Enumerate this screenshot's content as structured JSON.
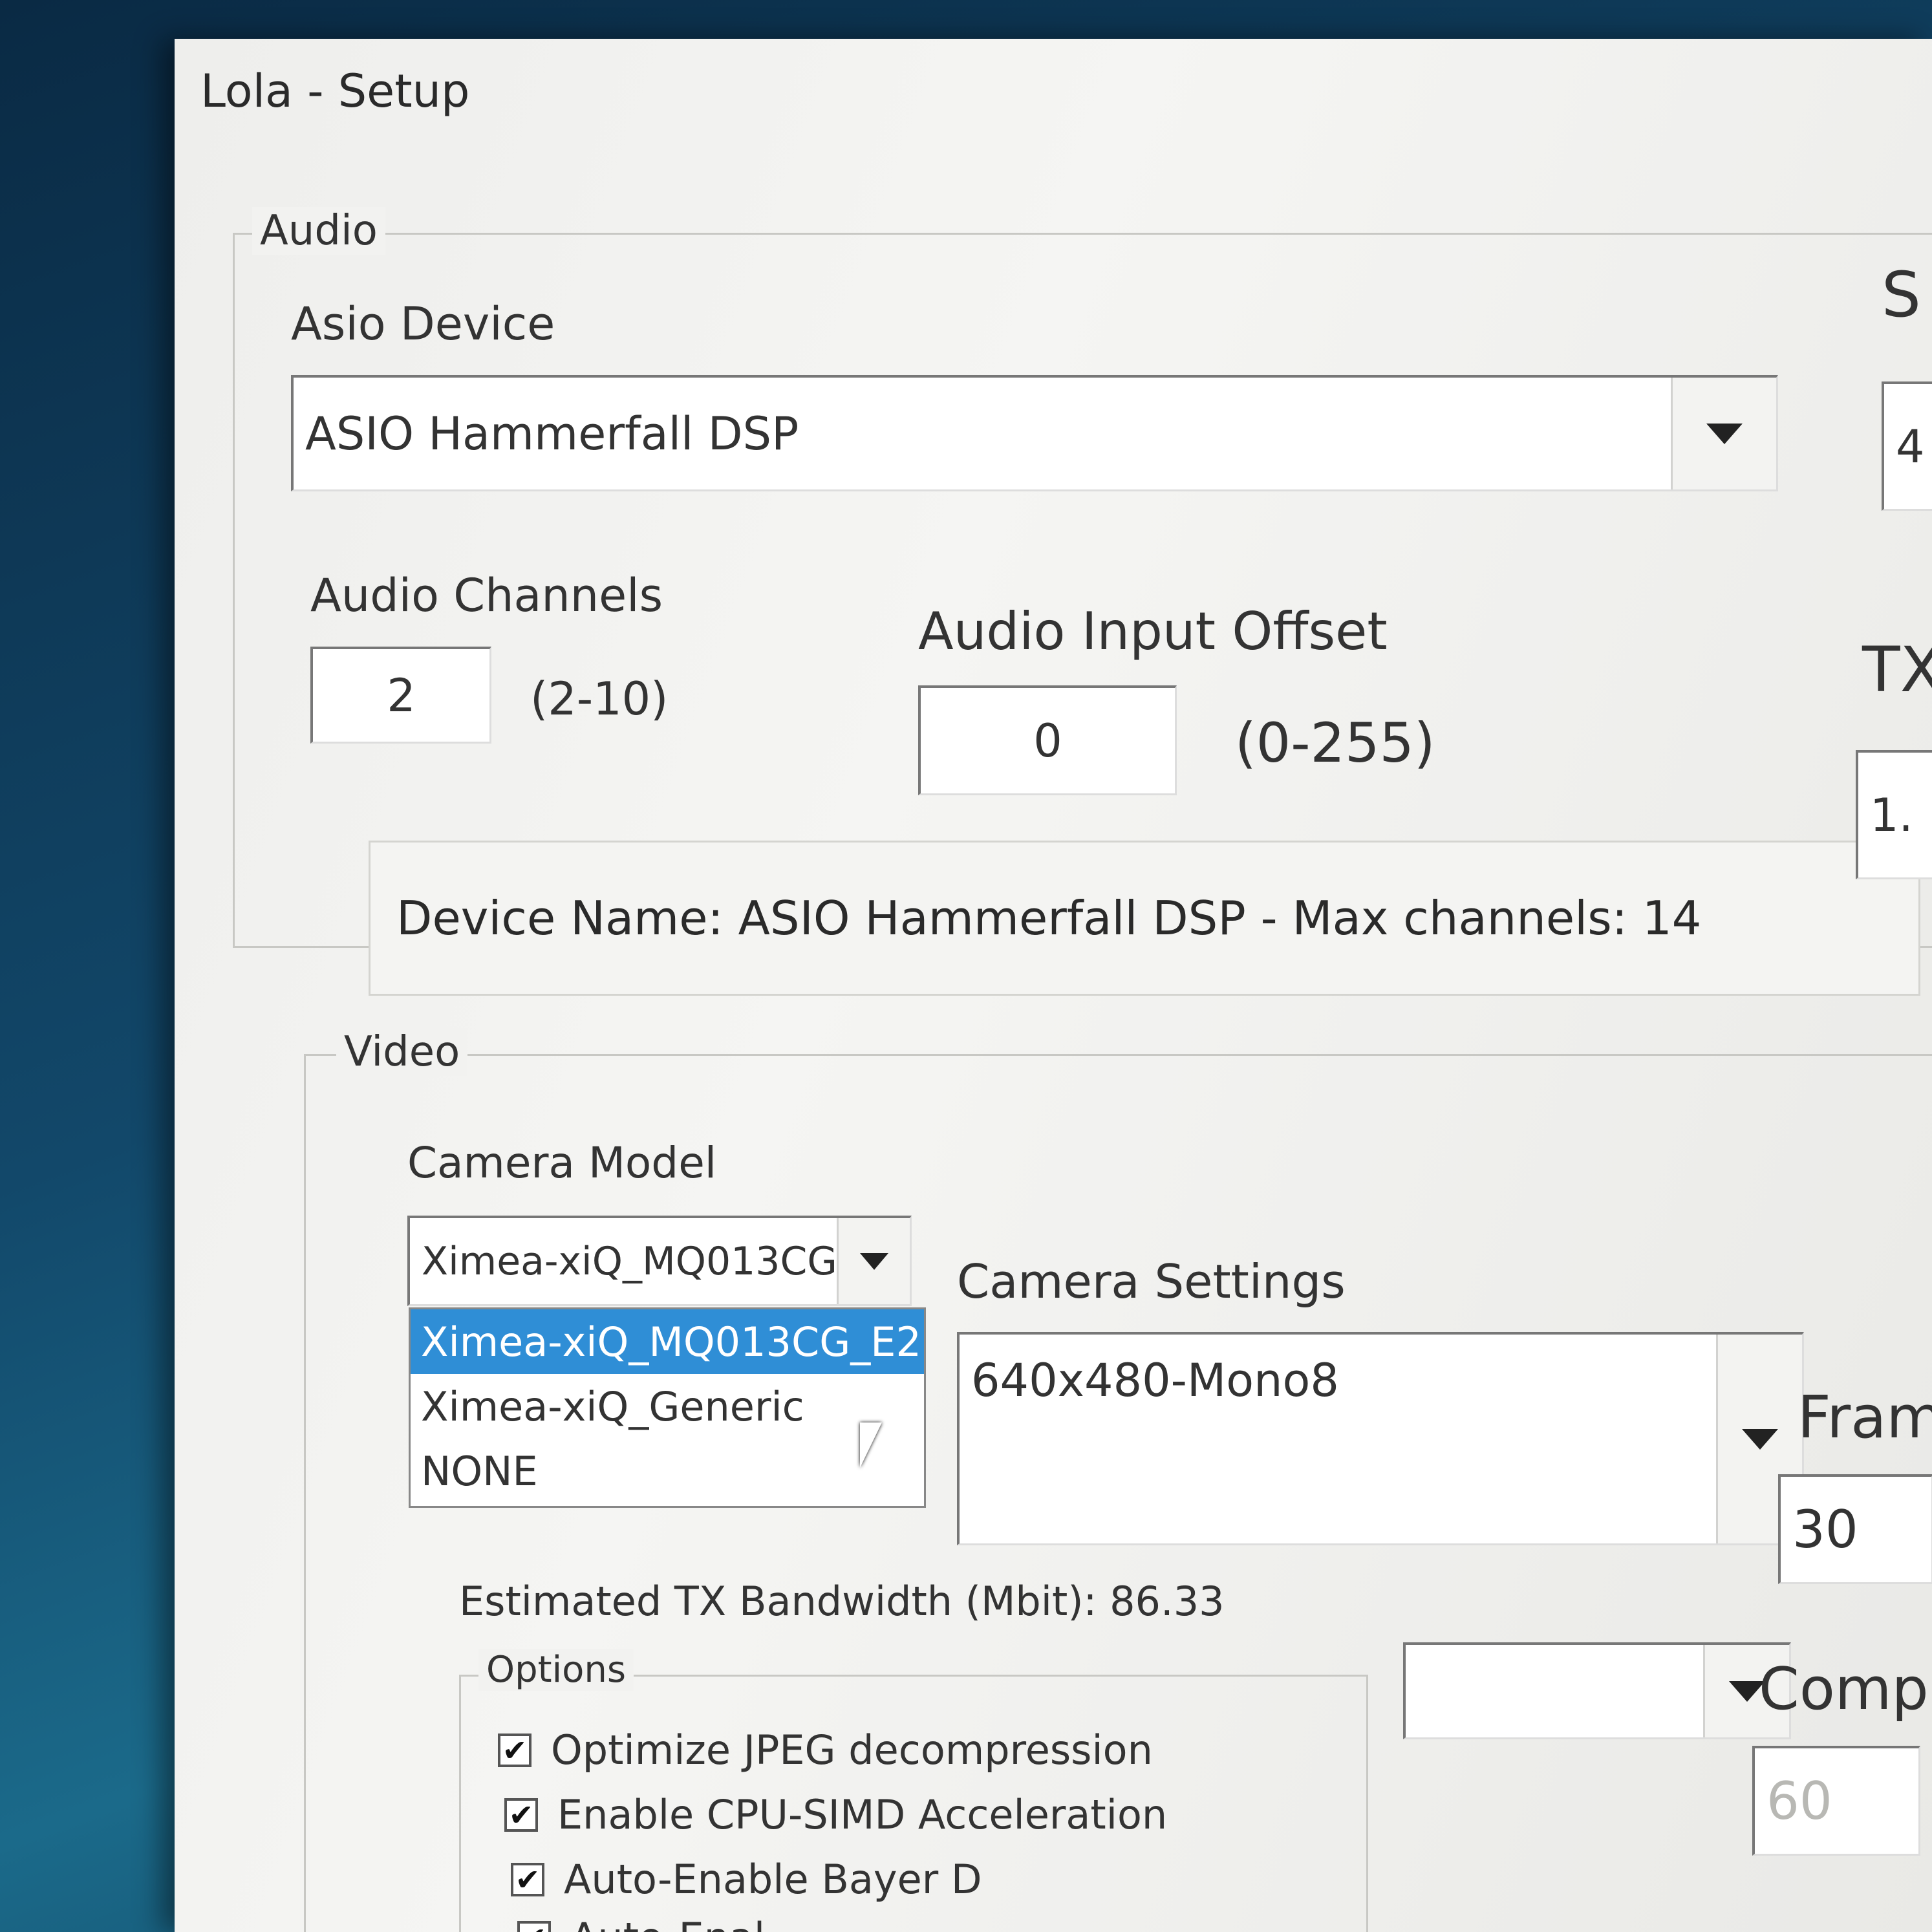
{
  "window": {
    "title": "Lola - Setup"
  },
  "audio": {
    "group_label": "Audio",
    "asio_device_label": "Asio Device",
    "asio_device_value": "ASIO Hammerfall DSP",
    "channels_label": "Audio Channels",
    "channels_value": "2",
    "channels_range": "(2-10)",
    "input_offset_label": "Audio Input Offset",
    "input_offset_value": "0",
    "input_offset_range": "(0-255)",
    "device_info": "Device Name: ASIO Hammerfall DSP - Max channels: 14"
  },
  "right_column": {
    "label_1_partial": "S",
    "field_1_partial": "4",
    "label_2_partial": "TX",
    "field_2_partial": "1.",
    "frame_label_partial": "Fram",
    "frame_value": "30",
    "comp_label_partial": "Comp",
    "comp_value": "60"
  },
  "video": {
    "group_label": "Video",
    "camera_model_label": "Camera Model",
    "camera_model_value": "Ximea-xiQ_MQ013CG_E2",
    "camera_model_options": [
      "Ximea-xiQ_MQ013CG_E2",
      "Ximea-xiQ_Generic",
      "NONE"
    ],
    "camera_settings_label": "Camera Settings",
    "camera_settings_value": "640x480-Mono8",
    "bandwidth_text": "Estimated TX Bandwidth (Mbit): 86.33"
  },
  "options": {
    "group_label": "Options",
    "items": [
      {
        "label": "Optimize JPEG decompression",
        "checked": true
      },
      {
        "label": "Enable CPU-SIMD Acceleration",
        "checked": true
      },
      {
        "label": "Auto-Enable Bayer D",
        "checked": true
      },
      {
        "label": "Auto-Enal",
        "checked": true
      }
    ]
  }
}
